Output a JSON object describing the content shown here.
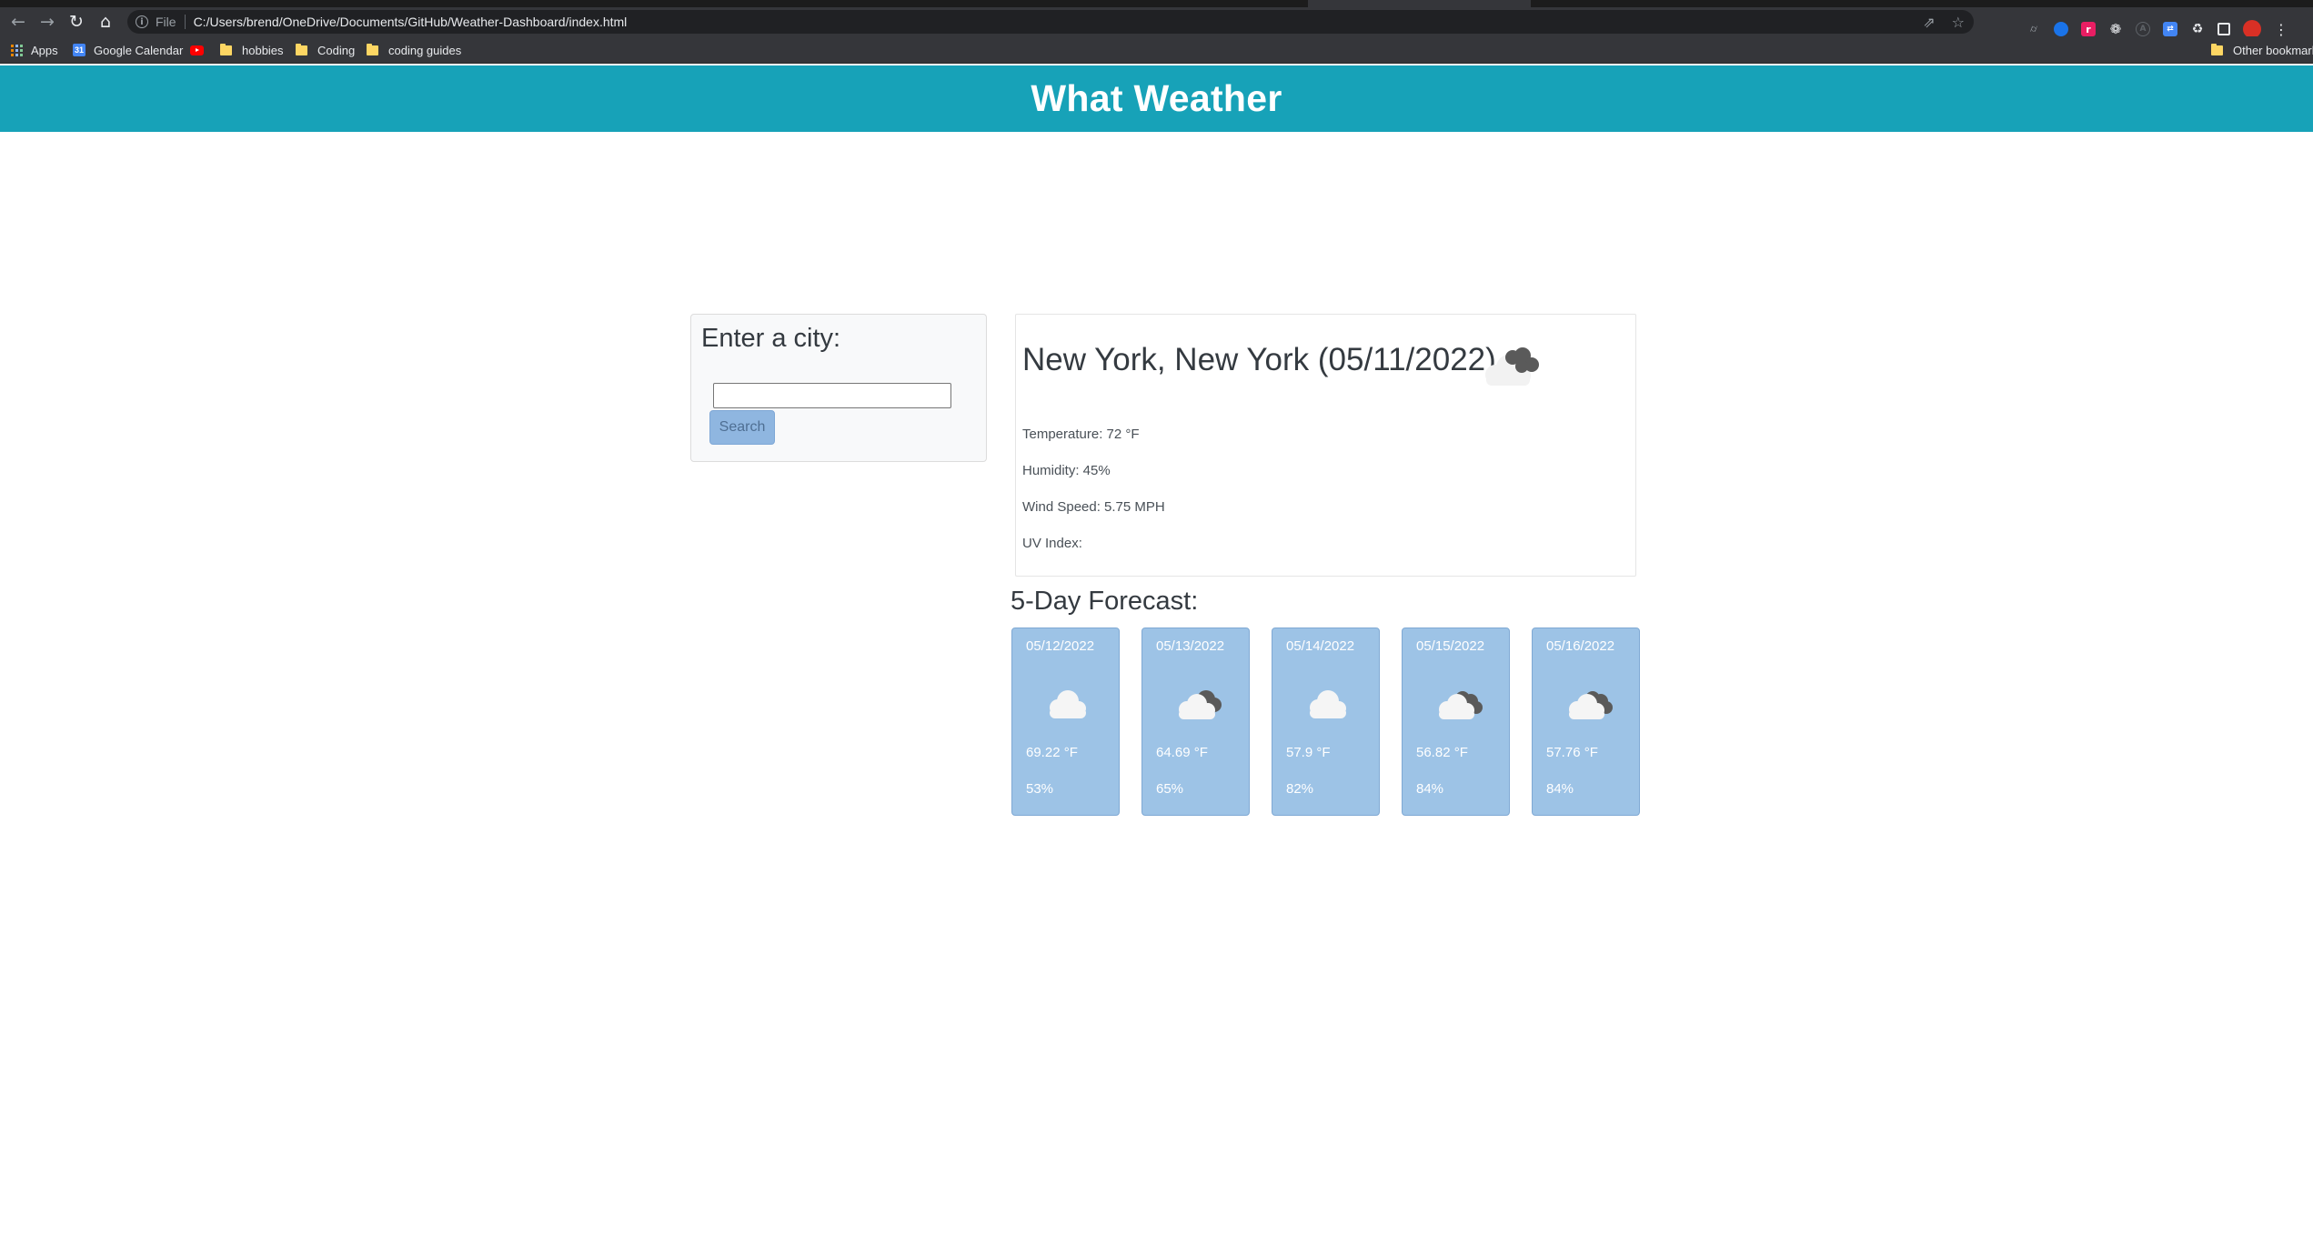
{
  "browser": {
    "scheme": "File",
    "url": "C:/Users/brend/OneDrive/Documents/GitHub/Weather-Dashboard/index.html",
    "bookmarks": [
      {
        "label": "Apps"
      },
      {
        "label": "Google Calendar"
      },
      {
        "label": "hobbies"
      },
      {
        "label": "Coding"
      },
      {
        "label": "coding guides"
      }
    ],
    "other_bookmarks": "Other bookmarks"
  },
  "header": {
    "title": "What Weather"
  },
  "search": {
    "heading": "Enter a city:",
    "input_value": "",
    "button_label": "Search"
  },
  "current": {
    "title": "New York, New York (05/11/2022)",
    "icon": "scattered-clouds-icon",
    "temperature": "Temperature: 72 °F",
    "humidity": "Humidity: 45%",
    "wind": "Wind Speed: 5.75 MPH",
    "uv": "UV Index:"
  },
  "forecast": {
    "title": "5-Day Forecast:",
    "days": [
      {
        "date": "05/12/2022",
        "icon": "cloud-icon",
        "temp": "69.22 °F",
        "humidity": "53%"
      },
      {
        "date": "05/13/2022",
        "icon": "cloud-dark-icon",
        "temp": "64.69 °F",
        "humidity": "65%"
      },
      {
        "date": "05/14/2022",
        "icon": "cloud-icon",
        "temp": "57.9 °F",
        "humidity": "82%"
      },
      {
        "date": "05/15/2022",
        "icon": "cloud-dark-icon",
        "temp": "56.82 °F",
        "humidity": "84%"
      },
      {
        "date": "05/16/2022",
        "icon": "cloud-dark-icon",
        "temp": "57.76 °F",
        "humidity": "84%"
      }
    ]
  },
  "colors": {
    "header_bg": "#17a2b8",
    "card_bg": "#9dc3e6",
    "button_bg": "#8fb6e0"
  }
}
